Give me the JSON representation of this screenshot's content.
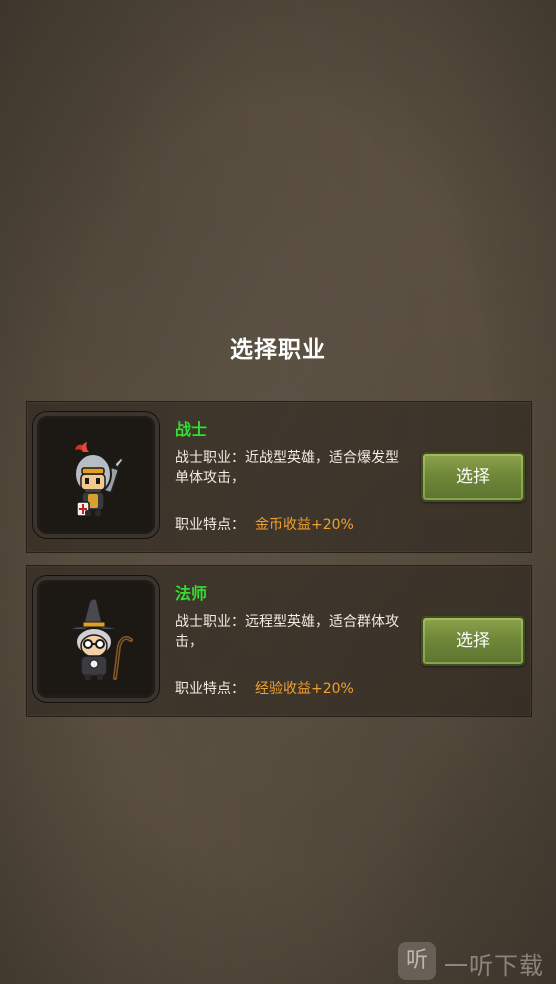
{
  "screen": {
    "title": "选择职业"
  },
  "classes": [
    {
      "name": "战士",
      "description": "战士职业：近战型英雄，适合爆发型单体攻击，",
      "trait_label": "职业特点：",
      "trait_value": "金币收益+20%",
      "select_label": "选择",
      "portrait_icon": "warrior-knight-icon"
    },
    {
      "name": "法师",
      "description": "战士职业：远程型英雄，适合群体攻击，",
      "trait_label": "职业特点：",
      "trait_value": "经验收益+20%",
      "select_label": "选择",
      "portrait_icon": "mage-witch-icon"
    }
  ],
  "watermark": {
    "icon_text": "听",
    "text": "一听下载"
  },
  "colors": {
    "class_name": "#33dd33",
    "trait_value": "#f0a030",
    "button": "#6f8838",
    "background": "#5a4f40"
  }
}
